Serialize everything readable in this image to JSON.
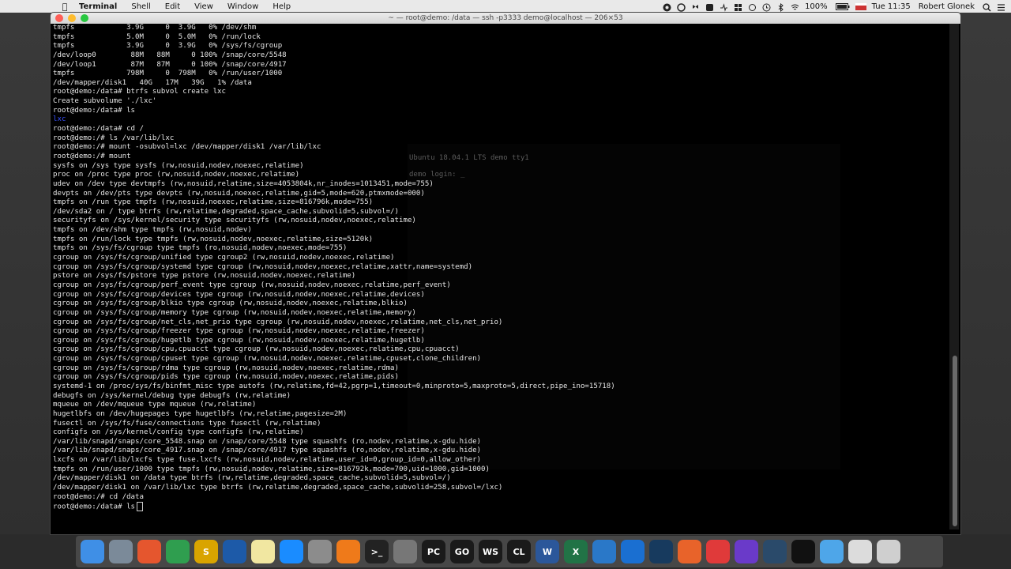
{
  "menubar": {
    "app_name": "Terminal",
    "menus": [
      "Shell",
      "Edit",
      "View",
      "Window",
      "Help"
    ],
    "battery": "100%",
    "clock": "Tue 11:35",
    "user": "Robert Glonek"
  },
  "window": {
    "title": "~ — root@demo: /data — ssh -p3333 demo@localhost — 206×53"
  },
  "background": {
    "vm_line1": "Ubuntu 18.04.1 LTS demo tty1",
    "vm_line2": "demo login: _"
  },
  "terminal_lines": [
    "tmpfs            3.9G     0  3.9G   0% /dev/shm",
    "tmpfs            5.0M     0  5.0M   0% /run/lock",
    "tmpfs            3.9G     0  3.9G   0% /sys/fs/cgroup",
    "/dev/loop0        88M   88M     0 100% /snap/core/5548",
    "/dev/loop1        87M   87M     0 100% /snap/core/4917",
    "tmpfs            798M     0  798M   0% /run/user/1000",
    "/dev/mapper/disk1   40G   17M   39G   1% /data",
    "root@demo:/data# btrfs subvol create lxc",
    "Create subvolume './lxc'",
    "root@demo:/data# ls",
    "lxc",
    "root@demo:/data# cd /",
    "root@demo:/# ls /var/lib/lxc",
    "root@demo:/# mount -osubvol=lxc /dev/mapper/disk1 /var/lib/lxc",
    "root@demo:/# mount",
    "sysfs on /sys type sysfs (rw,nosuid,nodev,noexec,relatime)",
    "proc on /proc type proc (rw,nosuid,nodev,noexec,relatime)",
    "udev on /dev type devtmpfs (rw,nosuid,relatime,size=4053804k,nr_inodes=1013451,mode=755)",
    "devpts on /dev/pts type devpts (rw,nosuid,noexec,relatime,gid=5,mode=620,ptmxmode=000)",
    "tmpfs on /run type tmpfs (rw,nosuid,noexec,relatime,size=816796k,mode=755)",
    "/dev/sda2 on / type btrfs (rw,relatime,degraded,space_cache,subvolid=5,subvol=/)",
    "securityfs on /sys/kernel/security type securityfs (rw,nosuid,nodev,noexec,relatime)",
    "tmpfs on /dev/shm type tmpfs (rw,nosuid,nodev)",
    "tmpfs on /run/lock type tmpfs (rw,nosuid,nodev,noexec,relatime,size=5120k)",
    "tmpfs on /sys/fs/cgroup type tmpfs (ro,nosuid,nodev,noexec,mode=755)",
    "cgroup on /sys/fs/cgroup/unified type cgroup2 (rw,nosuid,nodev,noexec,relatime)",
    "cgroup on /sys/fs/cgroup/systemd type cgroup (rw,nosuid,nodev,noexec,relatime,xattr,name=systemd)",
    "pstore on /sys/fs/pstore type pstore (rw,nosuid,nodev,noexec,relatime)",
    "cgroup on /sys/fs/cgroup/perf_event type cgroup (rw,nosuid,nodev,noexec,relatime,perf_event)",
    "cgroup on /sys/fs/cgroup/devices type cgroup (rw,nosuid,nodev,noexec,relatime,devices)",
    "cgroup on /sys/fs/cgroup/blkio type cgroup (rw,nosuid,nodev,noexec,relatime,blkio)",
    "cgroup on /sys/fs/cgroup/memory type cgroup (rw,nosuid,nodev,noexec,relatime,memory)",
    "cgroup on /sys/fs/cgroup/net_cls,net_prio type cgroup (rw,nosuid,nodev,noexec,relatime,net_cls,net_prio)",
    "cgroup on /sys/fs/cgroup/freezer type cgroup (rw,nosuid,nodev,noexec,relatime,freezer)",
    "cgroup on /sys/fs/cgroup/hugetlb type cgroup (rw,nosuid,nodev,noexec,relatime,hugetlb)",
    "cgroup on /sys/fs/cgroup/cpu,cpuacct type cgroup (rw,nosuid,nodev,noexec,relatime,cpu,cpuacct)",
    "cgroup on /sys/fs/cgroup/cpuset type cgroup (rw,nosuid,nodev,noexec,relatime,cpuset,clone_children)",
    "cgroup on /sys/fs/cgroup/rdma type cgroup (rw,nosuid,nodev,noexec,relatime,rdma)",
    "cgroup on /sys/fs/cgroup/pids type cgroup (rw,nosuid,nodev,noexec,relatime,pids)",
    "systemd-1 on /proc/sys/fs/binfmt_misc type autofs (rw,relatime,fd=42,pgrp=1,timeout=0,minproto=5,maxproto=5,direct,pipe_ino=15718)",
    "debugfs on /sys/kernel/debug type debugfs (rw,relatime)",
    "mqueue on /dev/mqueue type mqueue (rw,relatime)",
    "hugetlbfs on /dev/hugepages type hugetlbfs (rw,relatime,pagesize=2M)",
    "fusectl on /sys/fs/fuse/connections type fusectl (rw,relatime)",
    "configfs on /sys/kernel/config type configfs (rw,relatime)",
    "/var/lib/snapd/snaps/core_5548.snap on /snap/core/5548 type squashfs (ro,nodev,relatime,x-gdu.hide)",
    "/var/lib/snapd/snaps/core_4917.snap on /snap/core/4917 type squashfs (ro,nodev,relatime,x-gdu.hide)",
    "lxcfs on /var/lib/lxcfs type fuse.lxcfs (rw,nosuid,nodev,relatime,user_id=0,group_id=0,allow_other)",
    "tmpfs on /run/user/1000 type tmpfs (rw,nosuid,nodev,relatime,size=816792k,mode=700,uid=1000,gid=1000)",
    "/dev/mapper/disk1 on /data type btrfs (rw,relatime,degraded,space_cache,subvolid=5,subvol=/)",
    "/dev/mapper/disk1 on /var/lib/lxc type btrfs (rw,relatime,degraded,space_cache,subvolid=258,subvol=/lxc)",
    "root@demo:/# cd /data",
    "root@demo:/data# ls"
  ],
  "highlight_line_index": 10,
  "colors": {
    "terminal_bg": "#000000",
    "terminal_fg": "#e6e6e6",
    "dir_listing": "#3a52ff"
  },
  "dock_apps": [
    {
      "icon": "finder-icon",
      "label": "",
      "color": "#3f8fe6"
    },
    {
      "icon": "launchpad-icon",
      "label": "",
      "color": "#7b8a99"
    },
    {
      "icon": "firefox-icon",
      "label": "",
      "color": "#e5562e"
    },
    {
      "icon": "chrome-icon",
      "label": "",
      "color": "#2f9e4f"
    },
    {
      "icon": "sequel-icon",
      "label": "S",
      "color": "#d9a400"
    },
    {
      "icon": "virtualbox-icon",
      "label": "",
      "color": "#1d5aa8"
    },
    {
      "icon": "notes-icon",
      "label": "",
      "color": "#f1e7a1"
    },
    {
      "icon": "appstore-icon",
      "label": "",
      "color": "#1a8cff"
    },
    {
      "icon": "system-preferences-icon",
      "label": "",
      "color": "#8c8c8c"
    },
    {
      "icon": "sublime-icon",
      "label": "",
      "color": "#ef7a1a"
    },
    {
      "icon": "terminal-icon",
      "label": ">_",
      "color": "#222222"
    },
    {
      "icon": "script-editor-icon",
      "label": "",
      "color": "#777777"
    },
    {
      "icon": "pycharm-icon",
      "label": "PC",
      "color": "#1a1a1a"
    },
    {
      "icon": "goland-icon",
      "label": "GO",
      "color": "#1a1a1a"
    },
    {
      "icon": "webstorm-icon",
      "label": "WS",
      "color": "#1a1a1a"
    },
    {
      "icon": "clion-icon",
      "label": "CL",
      "color": "#1a1a1a"
    },
    {
      "icon": "word-icon",
      "label": "W",
      "color": "#2b579a"
    },
    {
      "icon": "excel-icon",
      "label": "X",
      "color": "#217346"
    },
    {
      "icon": "files-icon",
      "label": "",
      "color": "#2a78c8"
    },
    {
      "icon": "1password-icon",
      "label": "",
      "color": "#1a6fd1"
    },
    {
      "icon": "steam-icon",
      "label": "",
      "color": "#173a5e"
    },
    {
      "icon": "sourcetree-icon",
      "label": "",
      "color": "#e8632a"
    },
    {
      "icon": "no-entry-icon",
      "label": "",
      "color": "#e03a3a"
    },
    {
      "icon": "imovie-icon",
      "label": "",
      "color": "#6a3ac9"
    },
    {
      "icon": "quicktime-icon",
      "label": "",
      "color": "#2a4a6a"
    },
    {
      "icon": "screen-recorder-icon",
      "label": "",
      "color": "#111111"
    },
    {
      "icon": "folder-icon",
      "label": "",
      "color": "#4ea6e9"
    },
    {
      "icon": "documents-icon",
      "label": "",
      "color": "#dcdcdc"
    },
    {
      "icon": "trash-icon",
      "label": "",
      "color": "#cfcfcf"
    }
  ]
}
